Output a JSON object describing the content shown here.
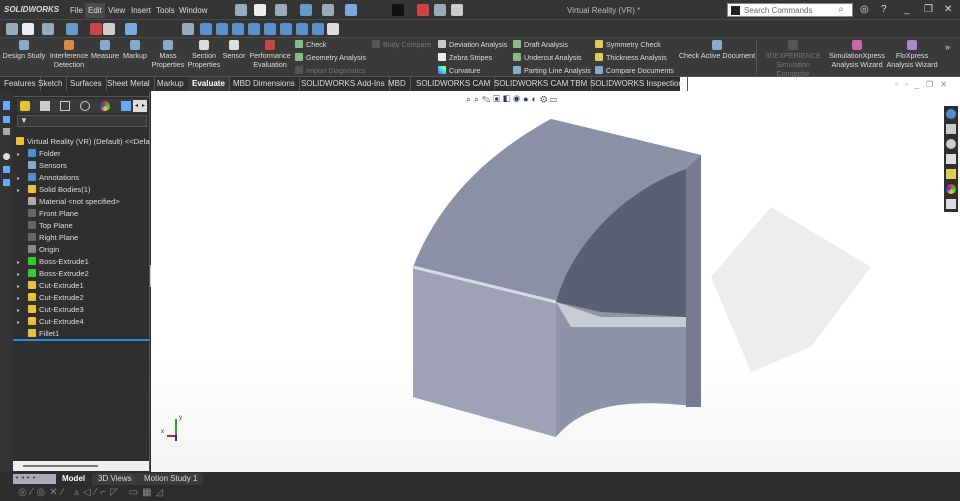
{
  "app": {
    "logo": "SOLIDWORKS",
    "title": "Virtual Reality (VR) *"
  },
  "menu": [
    "File",
    "Edit",
    "View",
    "Insert",
    "Tools",
    "Window"
  ],
  "search": {
    "placeholder": "Search Commands"
  },
  "ribbon": {
    "big": [
      "Design Study",
      "Interference Detection",
      "Measure",
      "Markup",
      "Mass Properties",
      "Section Properties",
      "Sensor",
      "Performance Evaluation"
    ],
    "col1": [
      "Check",
      "Geometry Analysis",
      "Import Diagnostics"
    ],
    "body_compare": "Body Compare",
    "col2": [
      "Deviation Analysis",
      "Zebra Stripes",
      "Curvature"
    ],
    "col3": [
      "Draft Analysis",
      "Undercut Analysis",
      "Parting Line Analysis"
    ],
    "col4": [
      "Symmetry Check",
      "Thickness Analysis",
      "Compare Documents"
    ],
    "check_active": "Check Active Document",
    "right": [
      "3DEXPERIENCE Simulation Connector",
      "SimulationXpress Analysis Wizard",
      "FloXpress Analysis Wizard"
    ]
  },
  "tabs": [
    "Features",
    "Sketch",
    "Surfaces",
    "Sheet Metal",
    "Markup",
    "Evaluate",
    "MBD Dimensions",
    "SOLIDWORKS Add-Ins",
    "MBD",
    "SOLIDWORKS CAM",
    "SOLIDWORKS CAM TBM",
    "SOLIDWORKS Inspection"
  ],
  "tree": {
    "root": "Virtual Reality (VR) (Default) <<Defa",
    "items": [
      "Folder",
      "Sensors",
      "Annotations",
      "Solid Bodies(1)",
      "Material <not specified>",
      "Front Plane",
      "Top Plane",
      "Right Plane",
      "Origin",
      "Boss-Extrude1",
      "Boss-Extrude2",
      "Cut-Extrude1",
      "Cut-Extrude2",
      "Cut-Extrude3",
      "Cut-Extrude4",
      "Fillet1"
    ]
  },
  "bottom_tabs": [
    "Model",
    "3D Views",
    "Motion Study 1"
  ],
  "axes": {
    "x": "x",
    "y": "y"
  }
}
